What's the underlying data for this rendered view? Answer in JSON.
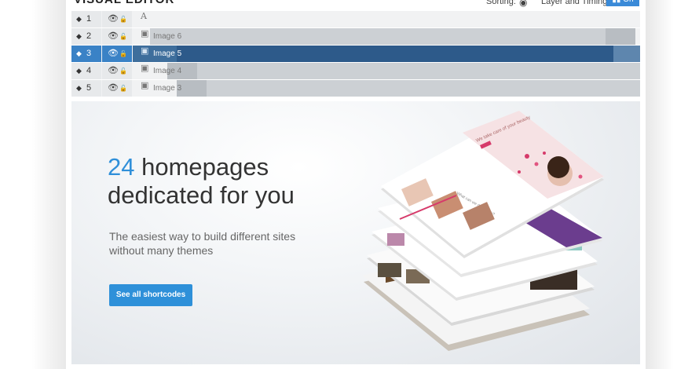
{
  "header": {
    "title": "VISUAL EDITOR",
    "sorting_label": "Sorting:",
    "layer_label": "Layer and Timing:",
    "toggle_label": "On"
  },
  "layers": [
    {
      "index": "1",
      "type": "text",
      "label": "",
      "active": false
    },
    {
      "index": "2",
      "type": "image",
      "label": "Image 6",
      "active": false
    },
    {
      "index": "3",
      "type": "image",
      "label": "Image 5",
      "active": true
    },
    {
      "index": "4",
      "type": "image",
      "label": "Image 4",
      "active": false
    },
    {
      "index": "5",
      "type": "image",
      "label": "Image 3",
      "active": false
    }
  ],
  "icons": {
    "sort": "sort-arrows-icon",
    "visibility": "eye-icon",
    "lock": "lock-icon",
    "text": "text-type-icon",
    "image": "image-type-icon"
  },
  "hero": {
    "headline_number": "24",
    "headline_rest_1": " homepages",
    "headline_line2": "dedicated for you",
    "subtitle_line1": "The easiest way to build different sites",
    "subtitle_line2": "without many themes",
    "cta_label": "See all shortcodes"
  },
  "mockup": {
    "hero_text": "We take care of your beauty",
    "section_text": "What can we do for you?"
  },
  "colors": {
    "accent": "#2f8fd9",
    "active_row": "#3a82c6",
    "active_bar": "#2d5a8a",
    "cta": "#2e90d9",
    "headline": "#333333"
  }
}
